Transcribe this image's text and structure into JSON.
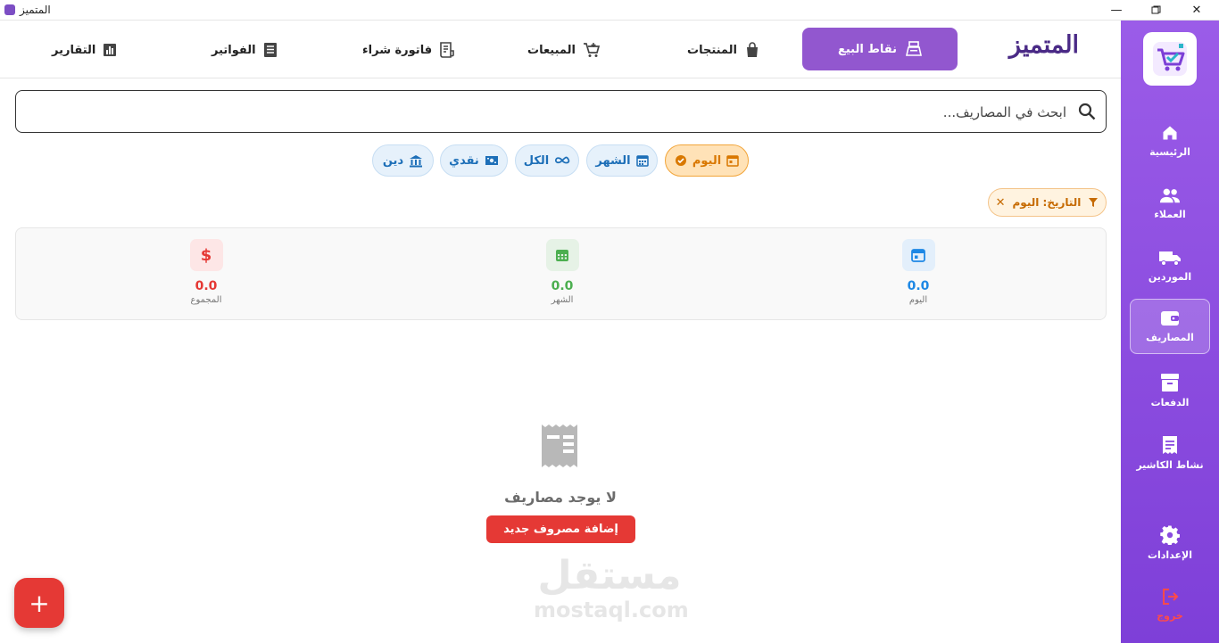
{
  "window": {
    "title": "المتميز"
  },
  "brand": {
    "name": "المتميز"
  },
  "topnav": {
    "pos_label": "نقاط البيع",
    "products_label": "المنتجات",
    "sales_label": "المبيعات",
    "purchase_invoice_label": "فاتورة شراء",
    "invoices_label": "الفواتير",
    "reports_label": "التقارير"
  },
  "sidebar": {
    "home": "الرئيسية",
    "customers": "العملاء",
    "suppliers": "الموردين",
    "expenses": "المصاريف",
    "payments": "الدفعات",
    "cashier_activity": "نشاط الكاشير",
    "settings": "الإعدادات",
    "logout": "خروج"
  },
  "search": {
    "placeholder": "ابحث في المصاريف..."
  },
  "filters": {
    "today": "اليوم",
    "month": "الشهر",
    "all": "الكل",
    "cash": "نقدي",
    "debt": "دين"
  },
  "date_tag": "التاريخ: اليوم",
  "stats": {
    "today_value": "0.0",
    "today_label": "اليوم",
    "month_value": "0.0",
    "month_label": "الشهر",
    "total_value": "0.0",
    "total_label": "المجموع"
  },
  "empty": {
    "message": "لا يوجد مصاريف",
    "add_button": "إضافة مصروف جديد"
  },
  "fab": "+",
  "watermark": {
    "line1": "مستقل",
    "line2": "mostaql.com"
  },
  "colors": {
    "sidebar": "#8a4be0",
    "primary": "#9257cf",
    "danger": "#e53935",
    "chip": "#1d6fb8",
    "active_chip": "#d97800",
    "month_green": "#4caf50"
  }
}
